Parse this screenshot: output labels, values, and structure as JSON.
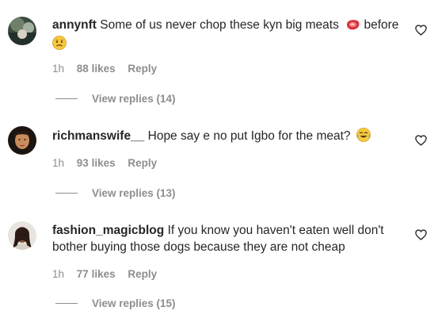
{
  "comments": [
    {
      "username": "annynft",
      "text": "Some of us never chop these kyn big meats",
      "text_after": "before",
      "emojis": [
        "steak-emoji",
        "worried-face-emoji"
      ],
      "time": "1h",
      "likes": "88 likes",
      "reply": "Reply",
      "view_replies": "View replies (14)"
    },
    {
      "username": "richmanswife__",
      "text": "Hope say e no put Igbo for the meat?",
      "emojis": [
        "tears-of-joy-emoji"
      ],
      "time": "1h",
      "likes": "93 likes",
      "reply": "Reply",
      "view_replies": "View replies (13)"
    },
    {
      "username": "fashion_magicblog",
      "text": "If you know you haven't eaten well don't bother buying those dogs because they are not cheap",
      "time": "1h",
      "likes": "77 likes",
      "reply": "Reply",
      "view_replies": "View replies (15)"
    }
  ],
  "icons": {
    "like": "heart-outline-icon"
  },
  "colors": {
    "text": "#262626",
    "secondary": "#8e8e8e",
    "background": "#ffffff"
  }
}
